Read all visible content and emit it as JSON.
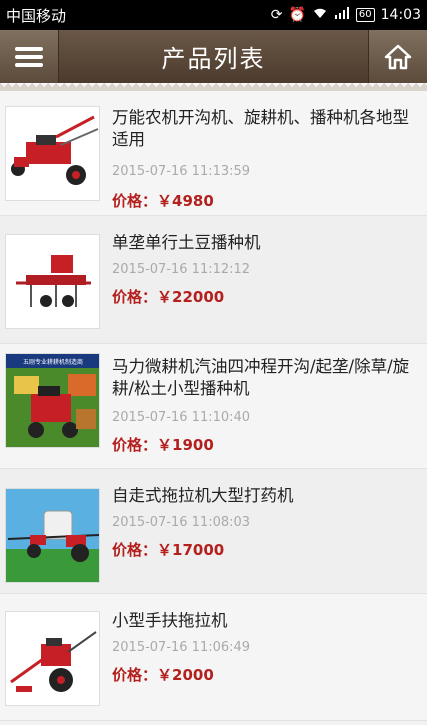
{
  "status_bar": {
    "carrier": "中国移动",
    "battery": "60",
    "time": "14:03"
  },
  "header": {
    "title": "产品列表",
    "menu_icon": "menu-icon",
    "home_icon": "home-icon"
  },
  "price_label": "价格：",
  "products": [
    {
      "name": " 万能农机开沟机、旋耕机、播种机各地型适用",
      "date": "2015-07-16 11:13:59",
      "price": "￥4980"
    },
    {
      "name": "单垄单行土豆播种机",
      "date": "2015-07-16 11:12:12",
      "price": "￥22000"
    },
    {
      "name": "马力微耕机汽油四冲程开沟/起垄/除草/旋耕/松土小型播种机",
      "date": "2015-07-16 11:10:40",
      "price": "￥1900",
      "image_banner": "五刚专业耕耕机制造商"
    },
    {
      "name": " 自走式拖拉机大型打药机",
      "date": "2015-07-16 11:08:03",
      "price": "￥17000"
    },
    {
      "name": "小型手扶拖拉机",
      "date": "2015-07-16 11:06:49",
      "price": "￥2000"
    }
  ],
  "colors": {
    "header": "#5a4837",
    "price": "#b3201e",
    "date": "#aaaaaa"
  }
}
